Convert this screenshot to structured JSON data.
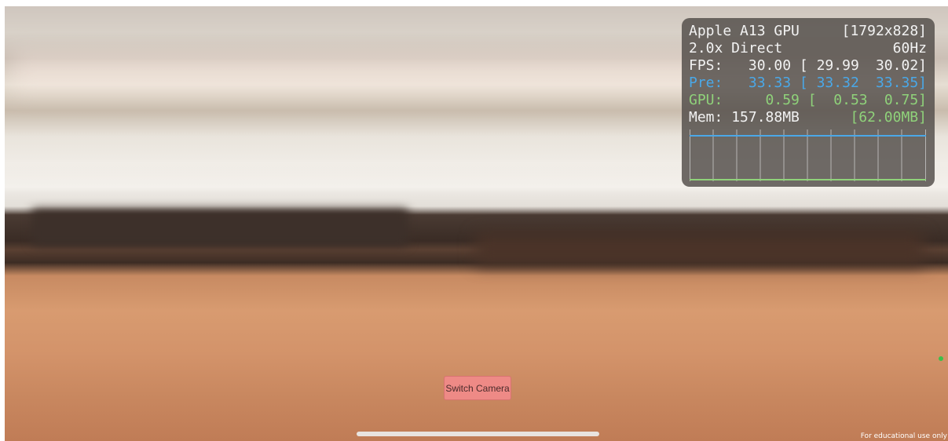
{
  "stats_overlay": {
    "gpu_name": "Apple A13 GPU",
    "resolution": "[1792x828]",
    "scale_mode": "2.0x Direct",
    "refresh_rate": "60Hz",
    "fps": {
      "label": "FPS:",
      "value": "30.00",
      "bracket": "[",
      "min": "29.99",
      "max": "30.02]"
    },
    "pre": {
      "label": "Pre:",
      "value": "33.33",
      "bracket": "[",
      "min": "33.32",
      "max": "33.35]"
    },
    "gpu": {
      "label": "GPU:",
      "value": "0.59",
      "bracket": "[",
      "min": "0.53",
      "max": "0.75]"
    },
    "mem": {
      "label": "Mem:",
      "value": "157.88MB",
      "limit": "[62.00MB]"
    },
    "graph": {
      "grid_line_color": "#d0d0d0",
      "pre_line_color": "#4aa8e8",
      "gpu_line_color": "#8fd27a"
    }
  },
  "switch_camera": {
    "label": "Switch Camera"
  },
  "watermark": "For educational use only",
  "colors": {
    "button": "#ee8a86",
    "status_dot": "#3bbf4a"
  }
}
